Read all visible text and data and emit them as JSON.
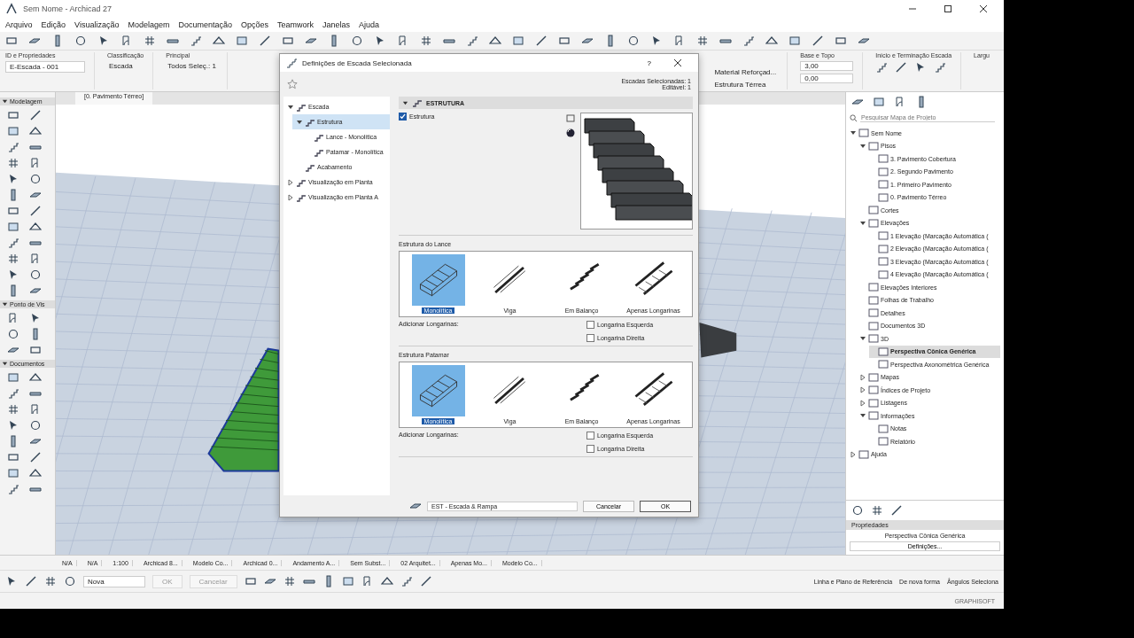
{
  "window": {
    "title": "Sem Nome - Archicad 27"
  },
  "menu": [
    "Arquivo",
    "Edição",
    "Visualização",
    "Modelagem",
    "Documentação",
    "Opções",
    "Teamwork",
    "Janelas",
    "Ajuda"
  ],
  "info_box": {
    "id_label": "ID e Propriedades",
    "id_value": "E-Escada - 001",
    "class_label": "Classificação",
    "class_value": "Escada",
    "main_label": "Principal",
    "main_sub": "Todos Seleç.: 1",
    "struct_values": [
      "Material Reforçad...",
      "Estrutura Térrea"
    ],
    "base_label": "Base e Topo",
    "base_values": [
      "3,00",
      "0,00"
    ],
    "ends_label": "Início e Terminação Escada",
    "last_label": "Largu"
  },
  "toolbox": {
    "sections": [
      {
        "label": "Modelagem",
        "expanded": true
      },
      {
        "label": "Ponto de Vis",
        "expanded": true
      },
      {
        "label": "Documentos",
        "expanded": true
      }
    ]
  },
  "view": {
    "tabs": [
      {
        "label": "[0. Pavimento Térreo]",
        "selected": true
      }
    ]
  },
  "dialog": {
    "title": "Definições de Escada Selecionada",
    "help": "?",
    "selection_info": [
      "Escadas Selecionadas: 1",
      "Editável: 1"
    ],
    "tree": [
      {
        "label": "Escada",
        "selected": false,
        "expanded": true,
        "children": [
          {
            "label": "Estrutura",
            "selected": true,
            "expanded": true,
            "children": [
              {
                "label": "Lance - Monolítica",
                "selected": false
              },
              {
                "label": "Patamar - Monolítica",
                "selected": false
              }
            ]
          },
          {
            "label": "Acabamento",
            "selected": false
          }
        ]
      },
      {
        "label": "Visualização em Planta",
        "selected": false,
        "expanded": false
      },
      {
        "label": "Visualização em Planta A",
        "selected": false,
        "expanded": false
      }
    ],
    "section_header": {
      "label": "ESTRUTURA",
      "expanded": true
    },
    "structure_check": {
      "label": "Estrutura",
      "checked": true
    },
    "groups": [
      {
        "title": "Estrutura do Lance",
        "options": [
          {
            "label": "Monolítica",
            "selected": true
          },
          {
            "label": "Viga",
            "selected": false
          },
          {
            "label": "Em Balanço",
            "selected": false
          },
          {
            "label": "Apenas Longarinas",
            "selected": false
          }
        ],
        "add_label": "Adicionar Longarinas:",
        "checks": [
          {
            "label": "Longarina Esquerda",
            "checked": false
          },
          {
            "label": "Longarina Direita",
            "checked": false
          }
        ]
      },
      {
        "title": "Estrutura Patamar",
        "options": [
          {
            "label": "Monolítica",
            "selected": true
          },
          {
            "label": "Viga",
            "selected": false
          },
          {
            "label": "Em Balanço",
            "selected": false
          },
          {
            "label": "Apenas Longarinas",
            "selected": false
          }
        ],
        "add_label": "Adicionar Longarinas:",
        "checks": [
          {
            "label": "Longarina Esquerda",
            "checked": false
          },
          {
            "label": "Longarina Direita",
            "checked": false
          }
        ]
      }
    ],
    "layer": "EST - Escada & Rampa",
    "buttons": [
      "Cancelar",
      "OK"
    ]
  },
  "navigator": {
    "search_placeholder": "Pesquisar Mapa de Projeto",
    "tree": [
      {
        "label": "Sem Nome",
        "selected": false,
        "expanded": true,
        "children": [
          {
            "label": "Pisos",
            "selected": false,
            "expanded": true,
            "children": [
              {
                "label": "3. Pavimento Cobertura",
                "selected": false
              },
              {
                "label": "2. Segundo Pavimento",
                "selected": false
              },
              {
                "label": "1. Primeiro Pavimento",
                "selected": false
              },
              {
                "label": "0. Pavimento Térreo",
                "selected": false
              }
            ]
          },
          {
            "label": "Cortes",
            "selected": false
          },
          {
            "label": "Elevações",
            "selected": false,
            "expanded": true,
            "children": [
              {
                "label": "1 Elevação (Marcação Automática (",
                "selected": false
              },
              {
                "label": "2 Elevação (Marcação Automática (",
                "selected": false
              },
              {
                "label": "3 Elevação (Marcação Automática (",
                "selected": false
              },
              {
                "label": "4 Elevação (Marcação Automática (",
                "selected": false
              }
            ]
          },
          {
            "label": "Elevações Interiores",
            "selected": false
          },
          {
            "label": "Folhas de Trabalho",
            "selected": false
          },
          {
            "label": "Detalhes",
            "selected": false
          },
          {
            "label": "Documentos 3D",
            "selected": false
          },
          {
            "label": "3D",
            "selected": false,
            "expanded": true,
            "children": [
              {
                "label": "Perspectiva Cônica Genérica",
                "selected": true
              },
              {
                "label": "Perspectiva Axonométrica Genérica",
                "selected": false
              }
            ]
          },
          {
            "label": "Mapas",
            "selected": false,
            "expanded": false
          },
          {
            "label": "Índices de Projeto",
            "selected": false,
            "expanded": false
          },
          {
            "label": "Listagens",
            "selected": false,
            "expanded": false
          },
          {
            "label": "Informações",
            "selected": false,
            "expanded": true,
            "children": [
              {
                "label": "Notas",
                "selected": false
              },
              {
                "label": "Relatório",
                "selected": false
              }
            ]
          }
        ]
      },
      {
        "label": "Ajuda",
        "selected": false,
        "expanded": false
      }
    ],
    "properties": {
      "header": "Propriedades",
      "view_name": "Perspectiva Cônica Genérica",
      "button": "Definições..."
    }
  },
  "bottom_bar": {
    "items": [
      "N/A",
      "N/A",
      "1:100",
      "Archicad 8...",
      "Modelo Co...",
      "Archicad 0...",
      "Andamento A...",
      "Sem Subst...",
      "02 Arquitet...",
      "Apenas Mo...",
      "Modelo Co..."
    ]
  },
  "edit_bar": {
    "pen_label": "Nova",
    "ok": "OK",
    "cancel": "Cancelar",
    "ref_line": "Linha e Plano de Referência",
    "mode": "De nova forma",
    "angles": "Ângulos Seleciona"
  },
  "status": {
    "brand": "GRAPHISOFT"
  }
}
